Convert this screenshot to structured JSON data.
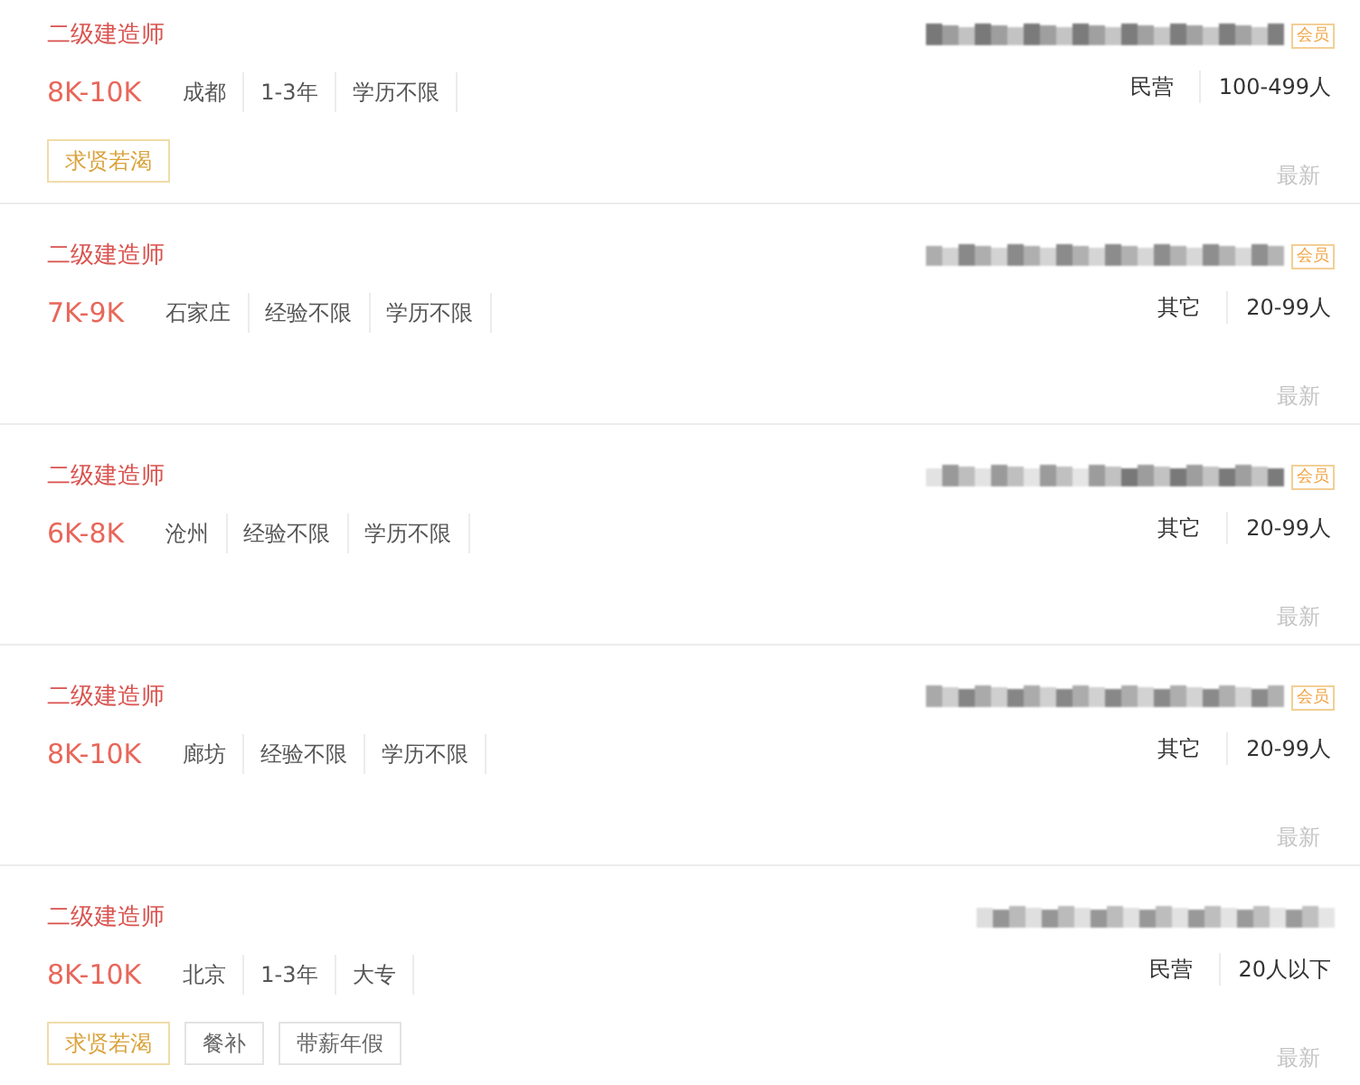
{
  "jobs": [
    {
      "title": "二级建造师",
      "salary": "8K-10K",
      "requirements": [
        "成都",
        "1-3年",
        "学历不限"
      ],
      "tags": [
        {
          "label": "求贤若渴",
          "kind": "highlight"
        }
      ],
      "member_badge": "会员",
      "company_type": "民营",
      "company_size": "100-499人",
      "freshness": "最新"
    },
    {
      "title": "二级建造师",
      "salary": "7K-9K",
      "requirements": [
        "石家庄",
        "经验不限",
        "学历不限"
      ],
      "member_badge": "会员",
      "company_type": "其它",
      "company_size": "20-99人",
      "freshness": "最新"
    },
    {
      "title": "二级建造师",
      "salary": "6K-8K",
      "requirements": [
        "沧州",
        "经验不限",
        "学历不限"
      ],
      "member_badge": "会员",
      "company_type": "其它",
      "company_size": "20-99人",
      "freshness": "最新"
    },
    {
      "title": "二级建造师",
      "salary": "8K-10K",
      "requirements": [
        "廊坊",
        "经验不限",
        "学历不限"
      ],
      "member_badge": "会员",
      "company_type": "其它",
      "company_size": "20-99人",
      "freshness": "最新"
    },
    {
      "title": "二级建造师",
      "salary": "8K-10K",
      "requirements": [
        "北京",
        "1-3年",
        "大专"
      ],
      "tags": [
        {
          "label": "求贤若渴",
          "kind": "highlight"
        },
        {
          "label": "餐补",
          "kind": "plain"
        },
        {
          "label": "带薪年假",
          "kind": "plain"
        }
      ],
      "company_type": "民营",
      "company_size": "20人以下",
      "freshness": "最新"
    }
  ]
}
